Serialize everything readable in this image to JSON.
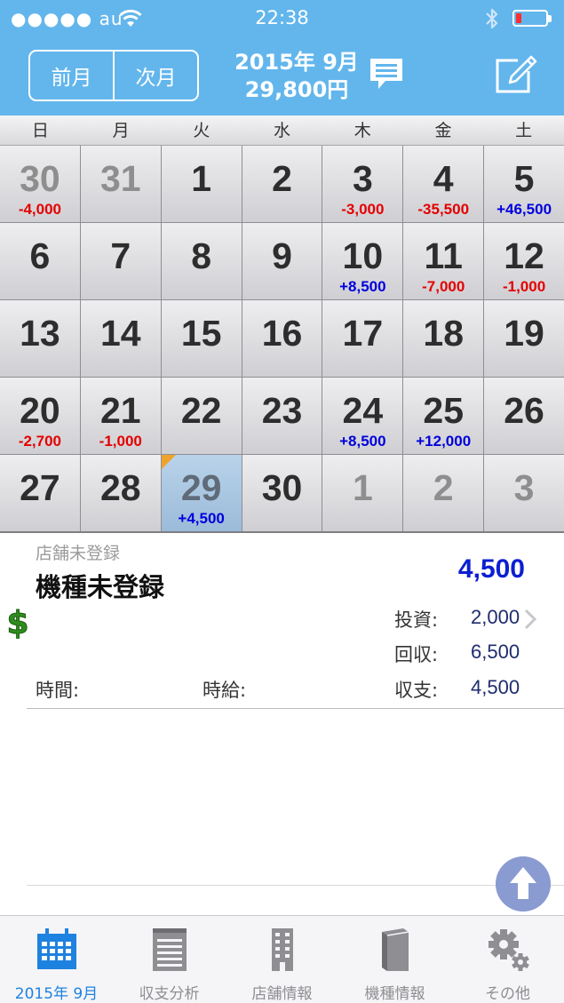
{
  "status": {
    "carrier": "●●●●● au",
    "time": "22:38"
  },
  "header": {
    "prev_label": "前月",
    "next_label": "次月",
    "month": "2015年 9月",
    "total": "29,800円"
  },
  "weekdays": [
    "日",
    "月",
    "火",
    "水",
    "木",
    "金",
    "土"
  ],
  "calendar": {
    "days": [
      {
        "d": "30",
        "amt": "-4,000",
        "sign": "neg",
        "other": true
      },
      {
        "d": "31",
        "amt": "",
        "sign": "",
        "other": true
      },
      {
        "d": "1",
        "amt": "",
        "sign": ""
      },
      {
        "d": "2",
        "amt": "",
        "sign": ""
      },
      {
        "d": "3",
        "amt": "-3,000",
        "sign": "neg"
      },
      {
        "d": "4",
        "amt": "-35,500",
        "sign": "neg"
      },
      {
        "d": "5",
        "amt": "+46,500",
        "sign": "pos"
      },
      {
        "d": "6",
        "amt": "",
        "sign": ""
      },
      {
        "d": "7",
        "amt": "",
        "sign": ""
      },
      {
        "d": "8",
        "amt": "",
        "sign": ""
      },
      {
        "d": "9",
        "amt": "",
        "sign": ""
      },
      {
        "d": "10",
        "amt": "+8,500",
        "sign": "pos"
      },
      {
        "d": "11",
        "amt": "-7,000",
        "sign": "neg"
      },
      {
        "d": "12",
        "amt": "-1,000",
        "sign": "neg"
      },
      {
        "d": "13",
        "amt": "",
        "sign": ""
      },
      {
        "d": "14",
        "amt": "",
        "sign": ""
      },
      {
        "d": "15",
        "amt": "",
        "sign": ""
      },
      {
        "d": "16",
        "amt": "",
        "sign": ""
      },
      {
        "d": "17",
        "amt": "",
        "sign": ""
      },
      {
        "d": "18",
        "amt": "",
        "sign": ""
      },
      {
        "d": "19",
        "amt": "",
        "sign": ""
      },
      {
        "d": "20",
        "amt": "-2,700",
        "sign": "neg"
      },
      {
        "d": "21",
        "amt": "-1,000",
        "sign": "neg"
      },
      {
        "d": "22",
        "amt": "",
        "sign": ""
      },
      {
        "d": "23",
        "amt": "",
        "sign": ""
      },
      {
        "d": "24",
        "amt": "+8,500",
        "sign": "pos"
      },
      {
        "d": "25",
        "amt": "+12,000",
        "sign": "pos"
      },
      {
        "d": "26",
        "amt": "",
        "sign": ""
      },
      {
        "d": "27",
        "amt": "",
        "sign": ""
      },
      {
        "d": "28",
        "amt": "",
        "sign": ""
      },
      {
        "d": "29",
        "amt": "+4,500",
        "sign": "pos",
        "selected": true
      },
      {
        "d": "30",
        "amt": "",
        "sign": ""
      },
      {
        "d": "1",
        "amt": "",
        "sign": "",
        "other": true
      },
      {
        "d": "2",
        "amt": "",
        "sign": "",
        "other": true
      },
      {
        "d": "3",
        "amt": "",
        "sign": "",
        "other": true
      }
    ]
  },
  "detail": {
    "shop": "店舗未登録",
    "model": "機種未登録",
    "total": "4,500",
    "invest_label": "投資:",
    "invest_value": "2,000",
    "recover_label": "回収:",
    "recover_value": "6,500",
    "balance_label": "収支:",
    "balance_value": "4,500",
    "time_label": "時間:",
    "wage_label": "時給:"
  },
  "tabs": [
    {
      "label": "2015年 9月",
      "icon": "calendar-icon",
      "active": true
    },
    {
      "label": "収支分析",
      "icon": "notepad-icon"
    },
    {
      "label": "店舗情報",
      "icon": "building-icon"
    },
    {
      "label": "機種情報",
      "icon": "book-icon"
    },
    {
      "label": "その他",
      "icon": "gear-icon"
    }
  ],
  "colors": {
    "header_blue": "#63b6ec",
    "negative": "#e40000",
    "positive": "#0000dd",
    "active_tab": "#1e82e0"
  }
}
